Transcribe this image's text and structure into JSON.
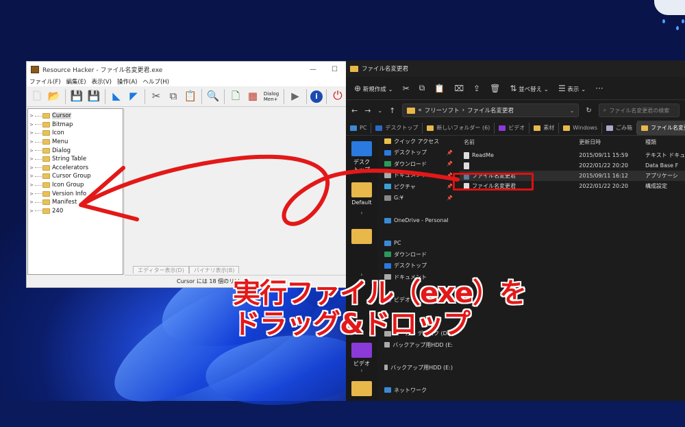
{
  "rh": {
    "title": "Resource Hacker - ファイル名変更君.exe",
    "menu": [
      "ファイル(F)",
      "編集(E)",
      "表示(V)",
      "操作(A)",
      "ヘルプ(H)"
    ],
    "dialog_btn": "Dialog\nMen+",
    "tree": [
      "Cursor",
      "Bitmap",
      "Icon",
      "Menu",
      "Dialog",
      "String Table",
      "Accelerators",
      "Cursor Group",
      "Icon Group",
      "Version Info",
      "Manifest",
      "240"
    ],
    "tab_editor": "エディター表示(D)",
    "tab_binary": "バイナリ表示(B)",
    "status": "Cursor には 18 個のリソ"
  },
  "ex": {
    "title": "ファイル名変更君",
    "tool_new": "新規作成",
    "tool_sort": "並べ替え",
    "tool_view": "表示",
    "path": [
      "«",
      "フリーソフト",
      "ファイル名変更君"
    ],
    "search_placeholder": "ファイル名変更君の検索",
    "tabs": [
      "PC",
      "デスクトップ",
      "新しいフォルダー (6)",
      "ビデオ",
      "素材",
      "Windows",
      "ごみ箱",
      "ファイル名変更君"
    ],
    "rail": [
      "デスクトップ",
      "Default",
      "ビデオ"
    ],
    "nav": [
      {
        "label": "クイック アクセス",
        "pin": ""
      },
      {
        "label": "デスクトップ",
        "pin": "📌"
      },
      {
        "label": "ダウンロード",
        "pin": "📌"
      },
      {
        "label": "ドキュメント",
        "pin": "📌"
      },
      {
        "label": "ピクチャ",
        "pin": "📌"
      },
      {
        "label": "G:¥",
        "pin": "📌"
      },
      {
        "label": "",
        "pin": ""
      },
      {
        "label": "OneDrive - Personal",
        "pin": ""
      },
      {
        "label": "",
        "pin": ""
      },
      {
        "label": "PC",
        "pin": ""
      },
      {
        "label": "ダウンロード",
        "pin": ""
      },
      {
        "label": "デスクトップ",
        "pin": ""
      },
      {
        "label": "ドキュメント",
        "pin": ""
      },
      {
        "label": "",
        "pin": ""
      },
      {
        "label": "ビデオ",
        "pin": ""
      },
      {
        "label": "",
        "pin": ""
      },
      {
        "label": "",
        "pin": ""
      },
      {
        "label": "ローカル ディスク (D:)",
        "pin": ""
      },
      {
        "label": "バックアップ用HDD (E:",
        "pin": ""
      },
      {
        "label": "",
        "pin": ""
      },
      {
        "label": "バックアップ用HDD (E:)",
        "pin": ""
      },
      {
        "label": "",
        "pin": ""
      },
      {
        "label": "ネットワーク",
        "pin": ""
      }
    ],
    "col_name": "名前",
    "col_date": "更新日時",
    "col_type": "種類",
    "files": [
      {
        "name": "ReadMe",
        "date": "2015/09/11 15:59",
        "type": "テキスト ドキュ"
      },
      {
        "name": "",
        "date": "2022/01/22 20:20",
        "type": "Data Base F"
      },
      {
        "name": "ファイル名変更君",
        "date": "2015/09/11 16:12",
        "type": "アプリケーシ"
      },
      {
        "name": "ファイル名変更君",
        "date": "2022/01/22 20:20",
        "type": "構成設定"
      }
    ]
  },
  "caption": {
    "line1": "実行ファイル（exe）を",
    "line2": "ドラッグ&ドロップ"
  },
  "colors": {
    "annotation": "#e31818",
    "explorer_bg": "#1c1c1c",
    "folder": "#e9b84a"
  }
}
